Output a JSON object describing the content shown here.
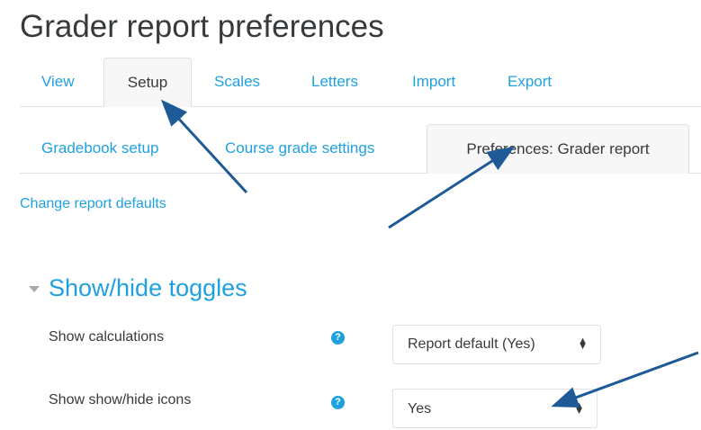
{
  "page": {
    "title": "Grader report preferences"
  },
  "primary_tabs": [
    {
      "label": "View"
    },
    {
      "label": "Setup"
    },
    {
      "label": "Scales"
    },
    {
      "label": "Letters"
    },
    {
      "label": "Import"
    },
    {
      "label": "Export"
    }
  ],
  "secondary_tabs": [
    {
      "label": "Gradebook setup"
    },
    {
      "label": "Course grade settings"
    },
    {
      "label": "Preferences: Grader report"
    }
  ],
  "active_primary_tab": "Setup",
  "active_secondary_tab": "Preferences: Grader report",
  "change_defaults_link": "Change report defaults",
  "section": {
    "title": "Show/hide toggles",
    "expanded": true
  },
  "settings": [
    {
      "label": "Show calculations",
      "value": "Report default (Yes)",
      "help_icon": "?"
    },
    {
      "label": "Show show/hide icons",
      "value": "Yes",
      "help_icon": "?"
    }
  ],
  "colors": {
    "link": "#1fa1e0",
    "text": "#373a3c",
    "annotation_arrow": "#1e5a96",
    "tab_active_bg": "#f7f7f7"
  }
}
